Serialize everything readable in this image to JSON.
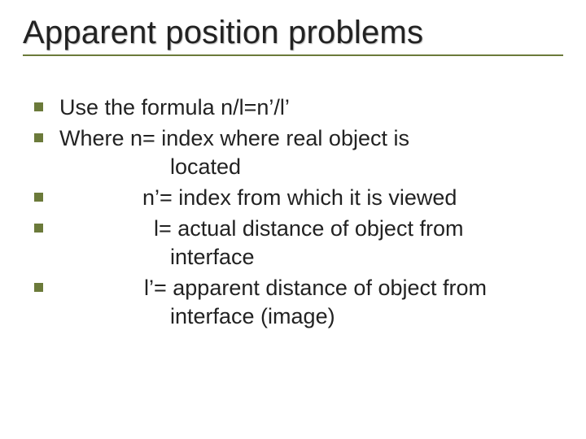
{
  "slide": {
    "title": "Apparent position problems",
    "bullets": [
      {
        "text": "Use the formula n/l=n’/l’",
        "cont": null,
        "contClass": ""
      },
      {
        "text": "Where n= index where real object is",
        "cont": "located",
        "contClass": "indent1"
      },
      {
        "text": "n’= index from which it is viewed",
        "textClass": "indent2",
        "cont": null,
        "contClass": ""
      },
      {
        "text": "l= actual distance of object from",
        "textClass": "indent3",
        "cont": "interface",
        "contClass": "indent1"
      },
      {
        "text": "l’= apparent distance of object from",
        "textClass": "indent4",
        "cont": "interface (image)",
        "contClass": "indent1"
      }
    ]
  }
}
